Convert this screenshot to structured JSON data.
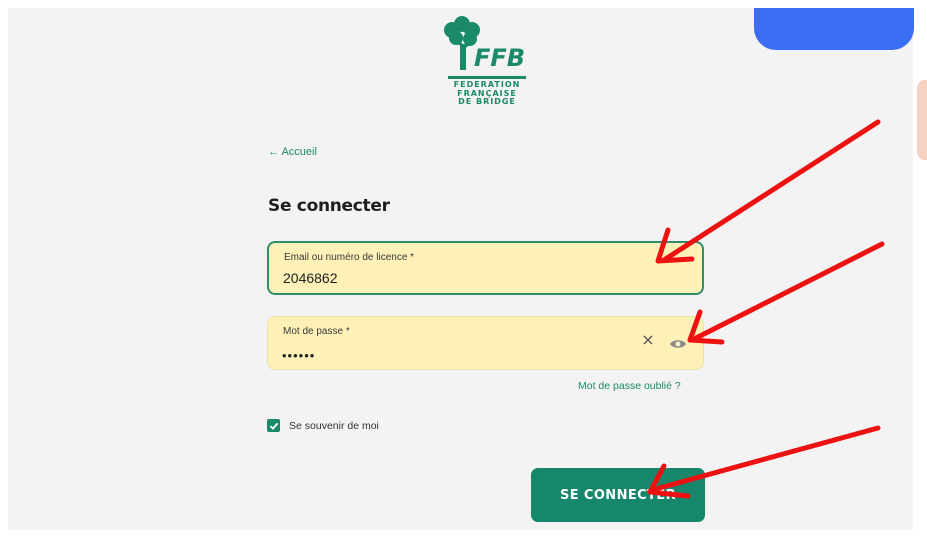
{
  "logo": {
    "mark": "FFB",
    "lines": [
      "FEDERATION",
      "FRANÇAISE",
      "DE BRIDGE"
    ],
    "brand_color": "#1b8a6b"
  },
  "nav": {
    "back_link": "← Accueil"
  },
  "form": {
    "title": "Se connecter",
    "email": {
      "label": "Email ou numéro de licence *",
      "value": "2046862"
    },
    "password": {
      "label": "Mot de passe *",
      "value": "••••••"
    },
    "clear_icon": "close-icon",
    "toggle_icon": "eye-icon",
    "forgot_link": "Mot de passe oublié ?",
    "remember": {
      "label": "Se souvenir de moi",
      "checked": true
    },
    "submit_label": "SE CONNECTER"
  },
  "colors": {
    "field_bg": "#fdf1b8",
    "button_bg": "#16876a",
    "accent_blue": "#3b6ef3",
    "annotation_red": "#ee1111"
  }
}
